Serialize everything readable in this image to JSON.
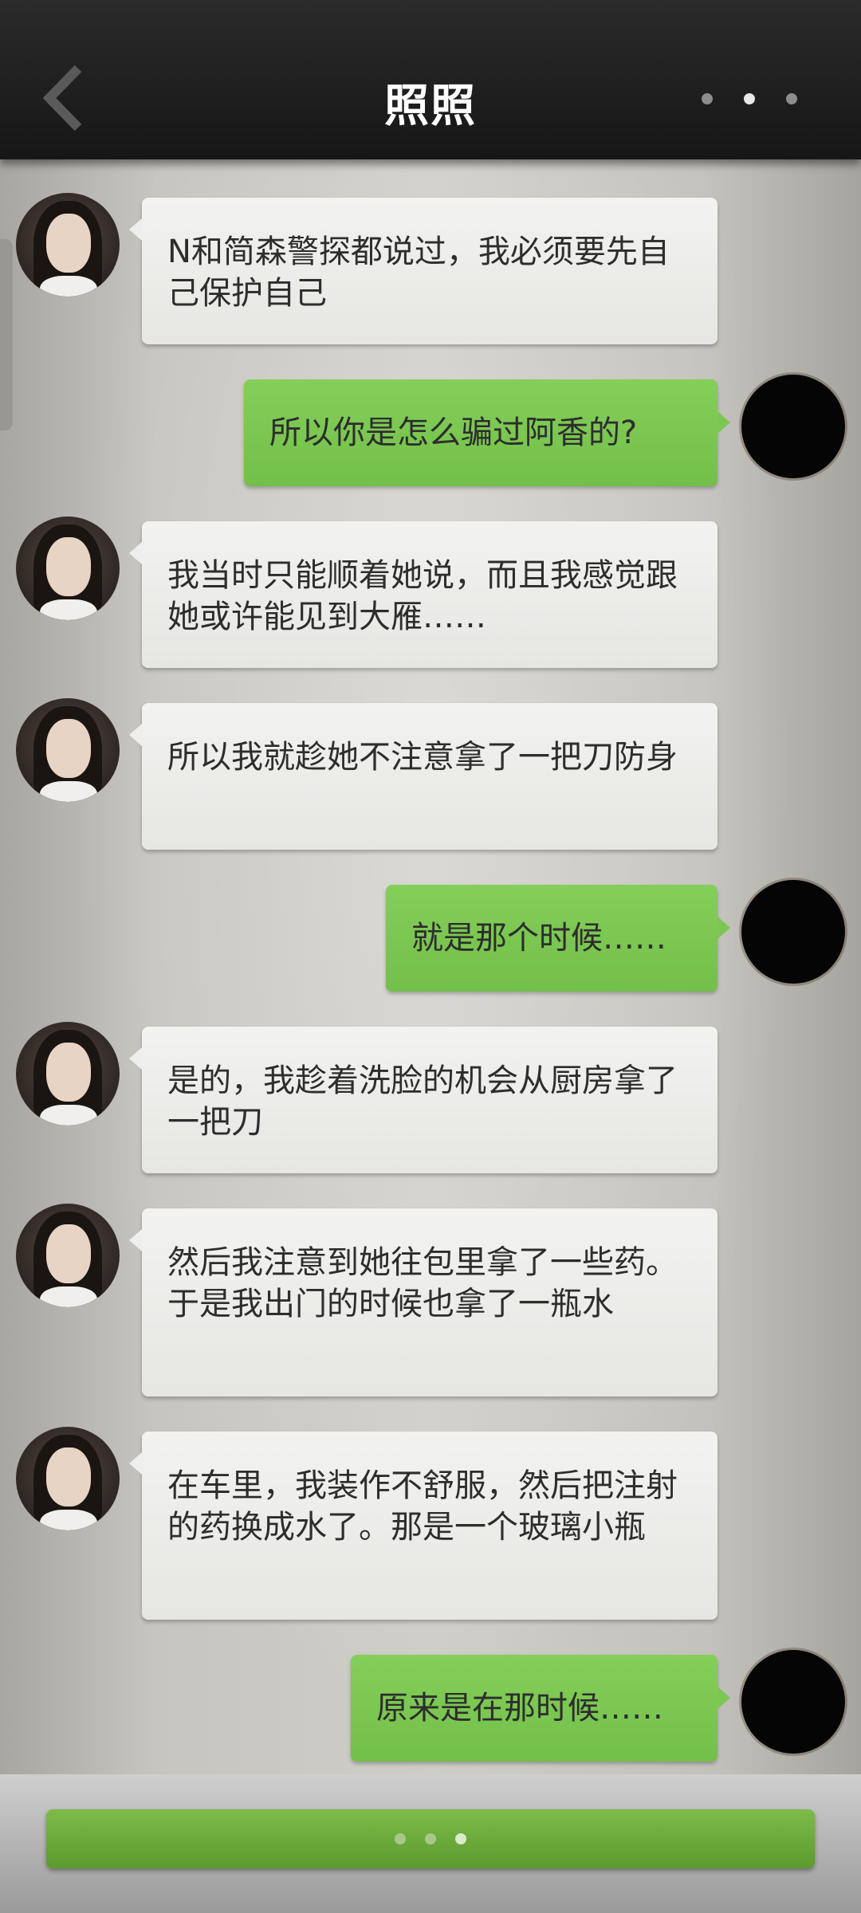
{
  "header": {
    "title": "照照",
    "back_icon": "chevron-left-icon",
    "more_icon": "more-dots-icon"
  },
  "messages": [
    {
      "side": "left",
      "text": "N和简森警探都说过，我必须要先自己保护自己"
    },
    {
      "side": "right",
      "text": "所以你是怎么骗过阿香的?"
    },
    {
      "side": "left",
      "text": "我当时只能顺着她说，而且我感觉跟她或许能见到大雁……"
    },
    {
      "side": "left",
      "text": "所以我就趁她不注意拿了一把刀防身"
    },
    {
      "side": "right",
      "text": "就是那个时候……"
    },
    {
      "side": "left",
      "text": "是的，我趁着洗脸的机会从厨房拿了一把刀"
    },
    {
      "side": "left",
      "text": "然后我注意到她往包里拿了一些药。于是我出门的时候也拿了一瓶水"
    },
    {
      "side": "left",
      "text": "在车里，我装作不舒服，然后把注射的药换成水了。那是一个玻璃小瓶"
    },
    {
      "side": "right",
      "text": "原来是在那时候……"
    }
  ],
  "footer": {
    "continue_icon": "loading-dots-icon"
  },
  "colors": {
    "header_bg": "#1e1e1e",
    "received_bubble": "#eeeeec",
    "sent_bubble": "#7bc753",
    "continue_button": "#6aa93b"
  }
}
